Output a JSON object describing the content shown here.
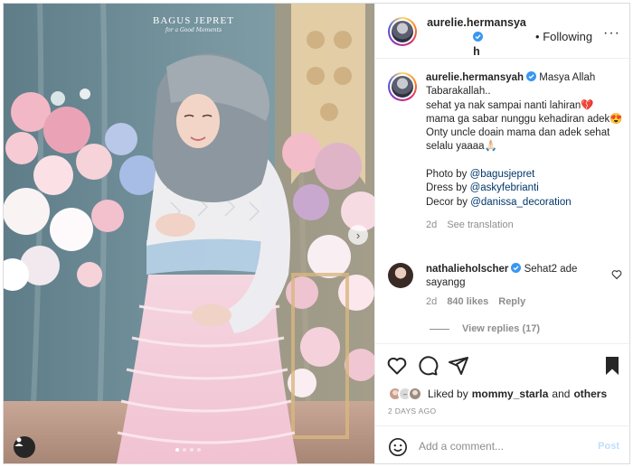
{
  "media": {
    "watermark_title": "BAGUS JEPRET",
    "watermark_subtitle": "for a Good Moments",
    "next_arrow": "›",
    "carousel_total": 4,
    "carousel_active": 1
  },
  "header": {
    "username_line1": "aurelie.hermansya",
    "username_line2": "h",
    "separator": "•",
    "following_label": "Following",
    "more_label": "···"
  },
  "caption": {
    "username": "aurelie.hermansyah",
    "lines": [
      "Masya Allah Tabarakallah..",
      "sehat ya nak sampai nanti lahiran💔",
      "mama ga sabar nunggu kehadiran adek😍",
      "Onty uncle doain mama dan adek sehat selalu yaaaa🙏🏻"
    ],
    "credits": [
      {
        "prefix": "Photo by ",
        "handle": "@bagusjepret"
      },
      {
        "prefix": "Dress by ",
        "handle": "@askyfebrianti"
      },
      {
        "prefix": "Decor by ",
        "handle": "@danissa_decoration"
      }
    ],
    "age": "2d",
    "see_translation": "See translation"
  },
  "comment": {
    "username": "nathalieholscher",
    "text": "Sehat2 ade sayangg",
    "age": "2d",
    "likes": "840 likes",
    "reply": "Reply",
    "view_replies": "View replies (17)"
  },
  "likes": {
    "prefix": "Liked by",
    "user": "mommy_starla",
    "and": "and",
    "others": "others"
  },
  "date": "2 DAYS AGO",
  "add_comment": {
    "placeholder": "Add a comment...",
    "post_label": "Post"
  },
  "colors": {
    "verified": "#3897f0",
    "link": "#00376b",
    "muted": "#8e8e8e",
    "post_disabled": "#c0dffd"
  },
  "icons": [
    "heart-icon",
    "comment-icon",
    "share-icon",
    "bookmark-icon",
    "emoji-icon",
    "user-tag-icon",
    "chevron-right-icon",
    "verified-icon"
  ]
}
